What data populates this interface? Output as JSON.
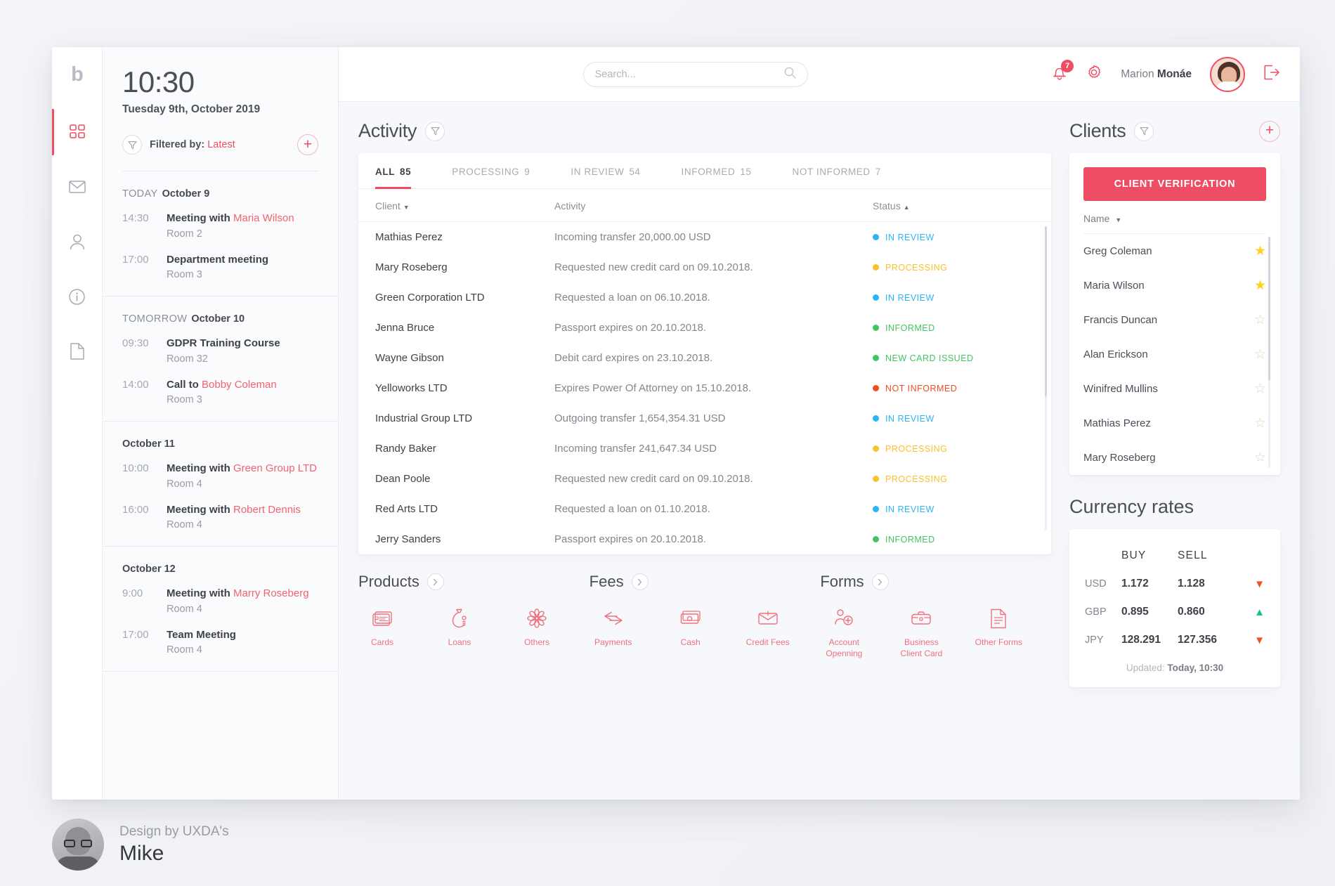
{
  "brand": {
    "logo": "b",
    "accent": "#ee4e63"
  },
  "rail": {
    "items": [
      {
        "name": "dashboard",
        "icon": "grid-icon",
        "active": true
      },
      {
        "name": "messages",
        "icon": "envelope-icon",
        "active": false
      },
      {
        "name": "clients",
        "icon": "person-icon",
        "active": false
      },
      {
        "name": "info",
        "icon": "info-icon",
        "active": false
      },
      {
        "name": "documents",
        "icon": "document-icon",
        "active": false
      }
    ]
  },
  "calendar": {
    "time": "10:30",
    "date": "Tuesday 9th, October 2019",
    "filter_icon": "filter-icon",
    "filter_label": "Filtered by:",
    "filter_value": "Latest",
    "add_label": "+",
    "groups": [
      {
        "relative": "TODAY",
        "date": "October 9",
        "events": [
          {
            "time": "14:30",
            "prefix": "Meeting with ",
            "highlight": "Maria Wilson",
            "room": "Room 2"
          },
          {
            "time": "17:00",
            "prefix": "Department meeting",
            "highlight": "",
            "room": "Room 3"
          }
        ]
      },
      {
        "relative": "TOMORROW",
        "date": "October 10",
        "events": [
          {
            "time": "09:30",
            "prefix": "GDPR Training Course",
            "highlight": "",
            "room": "Room 32"
          },
          {
            "time": "14:00",
            "prefix": "Call to ",
            "highlight": "Bobby Coleman",
            "room": "Room 3"
          }
        ]
      },
      {
        "relative": "",
        "date": "October 11",
        "events": [
          {
            "time": "10:00",
            "prefix": "Meeting with ",
            "highlight": "Green Group LTD",
            "room": "Room 4"
          },
          {
            "time": "16:00",
            "prefix": "Meeting with ",
            "highlight": "Robert Dennis",
            "room": "Room 4"
          }
        ]
      },
      {
        "relative": "",
        "date": "October 12",
        "events": [
          {
            "time": "9:00",
            "prefix": "Meeting with ",
            "highlight": "Marry Roseberg",
            "room": "Room 4"
          },
          {
            "time": "17:00",
            "prefix": "Team Meeting",
            "highlight": "",
            "room": "Room 4"
          }
        ]
      }
    ]
  },
  "topbar": {
    "search_placeholder": "Search...",
    "search_value": "",
    "search_icon": "search-icon",
    "notifications_icon": "bell-icon",
    "notifications_count": "7",
    "settings_icon": "gear-icon",
    "user_first": "Marion ",
    "user_last": "Monáe",
    "logout_icon": "logout-icon"
  },
  "activity": {
    "title": "Activity",
    "filter_icon": "filter-icon",
    "tabs": [
      {
        "label": "ALL",
        "count": "85",
        "active": true
      },
      {
        "label": "PROCESSING",
        "count": "9",
        "active": false
      },
      {
        "label": "IN REVIEW",
        "count": "54",
        "active": false
      },
      {
        "label": "INFORMED",
        "count": "15",
        "active": false
      },
      {
        "label": "NOT INFORMED",
        "count": "7",
        "active": false
      }
    ],
    "columns": {
      "client": "Client",
      "activity": "Activity",
      "status": "Status"
    },
    "sort_client": "▼",
    "sort_status": "▲",
    "rows": [
      {
        "client": "Mathias Perez",
        "activity": "Incoming transfer 20,000.00 USD",
        "status": "IN REVIEW",
        "color": "#29b6f6"
      },
      {
        "client": "Mary Roseberg",
        "activity": "Requested new credit card on 09.10.2018.",
        "status": "PROCESSING",
        "color": "#fbc02d"
      },
      {
        "client": "Green Corporation LTD",
        "activity": "Requested a loan on 06.10.2018.",
        "status": "IN REVIEW",
        "color": "#29b6f6"
      },
      {
        "client": "Jenna Bruce",
        "activity": "Passport expires on 20.10.2018.",
        "status": "INFORMED",
        "color": "#43c463"
      },
      {
        "client": "Wayne Gibson",
        "activity": "Debit card expires on 23.10.2018.",
        "status": "NEW CARD ISSUED",
        "color": "#43c463"
      },
      {
        "client": "Yelloworks LTD",
        "activity": "Expires Power Of Attorney on 15.10.2018.",
        "status": "NOT INFORMED",
        "color": "#f04e23"
      },
      {
        "client": "Industrial Group LTD",
        "activity": "Outgoing transfer 1,654,354.31 USD",
        "status": "IN REVIEW",
        "color": "#29b6f6"
      },
      {
        "client": "Randy Baker",
        "activity": "Incoming transfer 241,647.34 USD",
        "status": "PROCESSING",
        "color": "#fbc02d"
      },
      {
        "client": "Dean Poole",
        "activity": "Requested new credit card on 09.10.2018.",
        "status": "PROCESSING",
        "color": "#fbc02d"
      },
      {
        "client": "Red Arts LTD",
        "activity": "Requested a loan on 01.10.2018.",
        "status": "IN REVIEW",
        "color": "#29b6f6"
      },
      {
        "client": "Jerry Sanders",
        "activity": "Passport expires on 20.10.2018.",
        "status": "INFORMED",
        "color": "#43c463"
      }
    ]
  },
  "shortcuts": [
    {
      "title": "Products",
      "items": [
        {
          "label": "Cards",
          "icon": "card-icon"
        },
        {
          "label": "Loans",
          "icon": "money-bag-icon"
        },
        {
          "label": "Others",
          "icon": "flower-icon"
        }
      ]
    },
    {
      "title": "Fees",
      "items": [
        {
          "label": "Payments",
          "icon": "transfer-arrows-icon"
        },
        {
          "label": "Cash",
          "icon": "banknote-icon"
        },
        {
          "label": "Credit Fees",
          "icon": "envelope-card-icon"
        }
      ]
    },
    {
      "title": "Forms",
      "items": [
        {
          "label": "Account Openning",
          "icon": "add-person-icon"
        },
        {
          "label": "Business Client Card",
          "icon": "briefcase-icon"
        },
        {
          "label": "Other Forms",
          "icon": "file-text-icon"
        }
      ]
    }
  ],
  "clients": {
    "title": "Clients",
    "filter_icon": "filter-icon",
    "add_label": "+",
    "verify_button": "CLIENT VERIFICATION",
    "sort_label": "Name",
    "sort_arrow": "▼",
    "rows": [
      {
        "name": "Greg Coleman",
        "starred": true
      },
      {
        "name": "Maria Wilson",
        "starred": true
      },
      {
        "name": "Francis Duncan",
        "starred": false
      },
      {
        "name": "Alan Erickson",
        "starred": false
      },
      {
        "name": "Winifred Mullins",
        "starred": false
      },
      {
        "name": "Mathias Perez",
        "starred": false
      },
      {
        "name": "Mary Roseberg",
        "starred": false
      }
    ]
  },
  "currency": {
    "title": "Currency rates",
    "head_buy": "BUY",
    "head_sell": "SELL",
    "rows": [
      {
        "code": "USD",
        "buy": "1.172",
        "sell": "1.128",
        "trend": "down"
      },
      {
        "code": "GBP",
        "buy": "0.895",
        "sell": "0.860",
        "trend": "up"
      },
      {
        "code": "JPY",
        "buy": "128.291",
        "sell": "127.356",
        "trend": "down"
      }
    ],
    "updated_label": "Updated: ",
    "updated_value": "Today, 10:30"
  },
  "credit": {
    "line1": "Design by UXDA's",
    "line2": "Mike"
  }
}
